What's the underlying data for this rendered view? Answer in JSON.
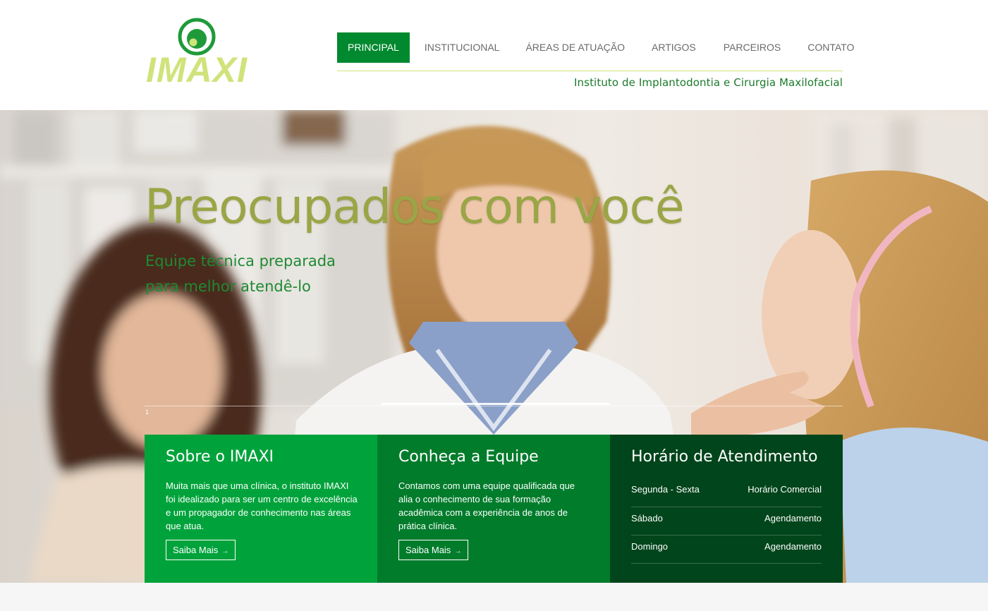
{
  "brand": {
    "logo_text": "IMAXI",
    "tagline": "Instituto de Implantodontia e Cirurgia Maxilofacial",
    "colors": {
      "primary": "#00892f",
      "logo_lime": "#cfe37a",
      "dark_green": "#00451b"
    }
  },
  "nav": {
    "items": [
      {
        "label": "PRINCIPAL",
        "active": true
      },
      {
        "label": "INSTITUCIONAL",
        "active": false
      },
      {
        "label": "ÁREAS DE ATUAÇÃO",
        "active": false
      },
      {
        "label": "ARTIGOS",
        "active": false
      },
      {
        "label": "PARCEIROS",
        "active": false
      },
      {
        "label": "CONTATO",
        "active": false
      }
    ]
  },
  "hero": {
    "title": "Preocupados com você",
    "subtitle": "Equipe técnica preparada para melhor atendê-lo",
    "slide_number": "1"
  },
  "boxes": {
    "about": {
      "title": "Sobre o IMAXI",
      "text": "Muita mais que uma clínica, o instituto IMAXI foi idealizado para ser um centro de excelência e um propagador de conhecimento nas áreas que atua.",
      "button": "Saiba Mais",
      "button_icon": "→"
    },
    "team": {
      "title": "Conheça a Equipe",
      "text": "Contamos com uma equipe qualificada que alia o conhecimento de sua formação acadêmica com a experiência de anos de prática clínica.",
      "button": "Saiba Mais",
      "button_icon": "→"
    },
    "hours": {
      "title": "Horário de Atendimento",
      "rows": [
        {
          "day": "Segunda - Sexta",
          "value": "Horário Comercial"
        },
        {
          "day": "Sábado",
          "value": "Agendamento"
        },
        {
          "day": "Domingo",
          "value": "Agendamento"
        }
      ]
    }
  }
}
